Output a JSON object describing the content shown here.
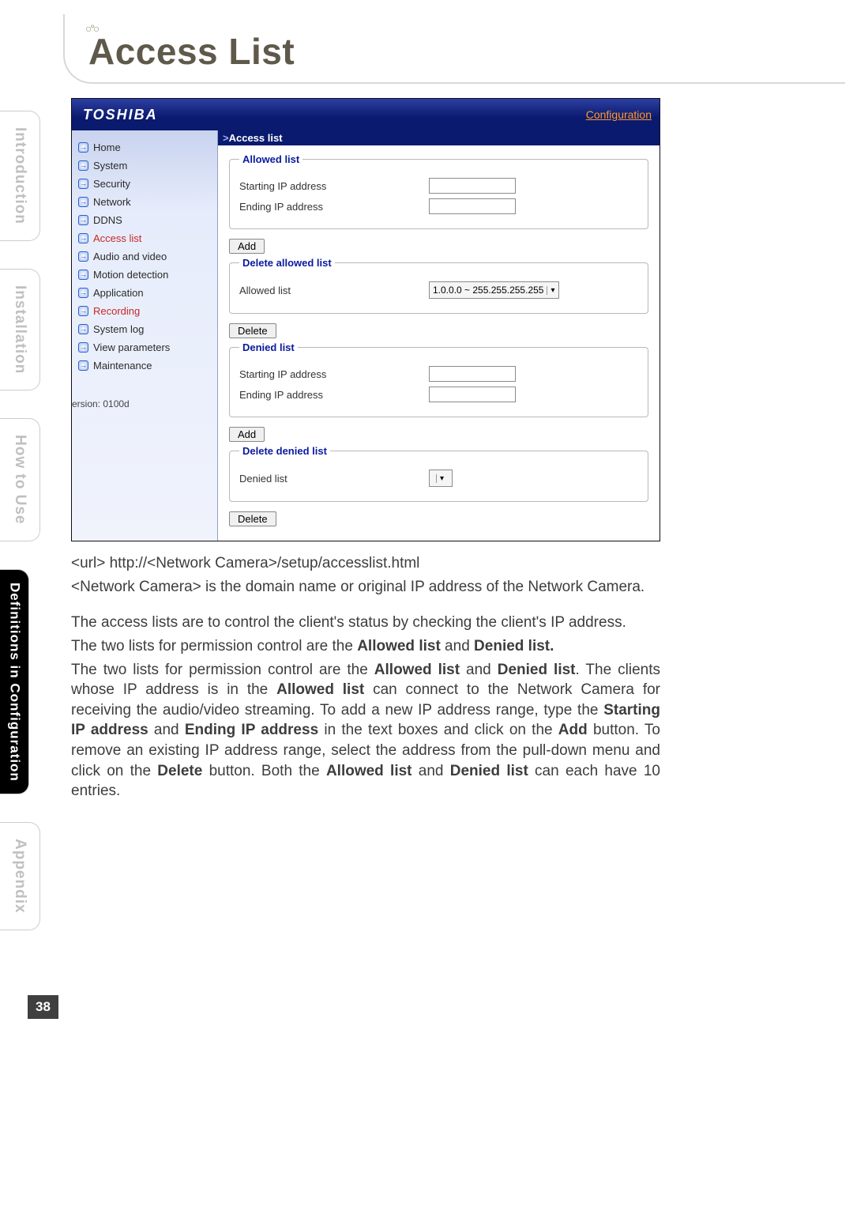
{
  "page": {
    "title": "Access List",
    "number": "38"
  },
  "side_tabs": [
    {
      "label": "Introduction",
      "active": false
    },
    {
      "label": "Installation",
      "active": false
    },
    {
      "label": "How to Use",
      "active": false
    },
    {
      "label": "Definitions in\nConfiguration",
      "active": true
    },
    {
      "label": "Appendix",
      "active": false
    }
  ],
  "panel": {
    "brand": "TOSHIBA",
    "conf_link": "Configuration",
    "breadcrumb": "Access list",
    "nav": [
      "Home",
      "System",
      "Security",
      "Network",
      "DDNS",
      "Access list",
      "Audio and video",
      "Motion detection",
      "Application",
      "Recording",
      "System log",
      "View parameters",
      "Maintenance"
    ],
    "nav_red_indexes": [
      5,
      9
    ],
    "version": "ersion: 0100d",
    "allowed": {
      "legend": "Allowed list",
      "start_label": "Starting IP address",
      "end_label": "Ending IP address",
      "add_btn": "Add"
    },
    "allowed_delete": {
      "legend": "Delete allowed list",
      "list_label": "Allowed list",
      "select_value": "1.0.0.0 ~ 255.255.255.255",
      "delete_btn": "Delete"
    },
    "denied": {
      "legend": "Denied list",
      "start_label": "Starting IP address",
      "end_label": "Ending IP address",
      "add_btn": "Add"
    },
    "denied_delete": {
      "legend": "Delete denied list",
      "list_label": "Denied list",
      "select_value": "",
      "delete_btn": "Delete"
    }
  },
  "body": {
    "url_line": "<url> http://<Network Camera>/setup/accesslist.html",
    "url_note": "<Network Camera> is the domain name or original IP address of the Network Camera.",
    "p1": "The access lists are to control the client's status by checking the client's IP address.",
    "p2a": "The two lists for permission control are the ",
    "p2b1": "Allowed list",
    "p2c": " and ",
    "p2b2": "Denied list.",
    "p3a": "The two lists for permission control are the ",
    "p3b1": "Allowed list",
    "p3c": " and ",
    "p3b2": "Denied list",
    "p3d": ". The clients whose IP address is in the ",
    "p3b3": "Allowed list",
    "p3e": " can connect to the Network Camera for receiving the audio/video streaming. To add a new IP address range, type the ",
    "p3b4": "Starting IP address",
    "p3f": " and ",
    "p3b5": "Ending IP address",
    "p3g": " in the text boxes and click on the ",
    "p3b6": "Add",
    "p3h": " button.  To remove an existing IP address range, select the address from the pull-down menu and click on the ",
    "p3b7": "Delete",
    "p3i": " button. Both the ",
    "p3b8": "Allowed list",
    "p3j": " and ",
    "p3b9": "Denied list",
    "p3k": " can each have 10 entries."
  }
}
